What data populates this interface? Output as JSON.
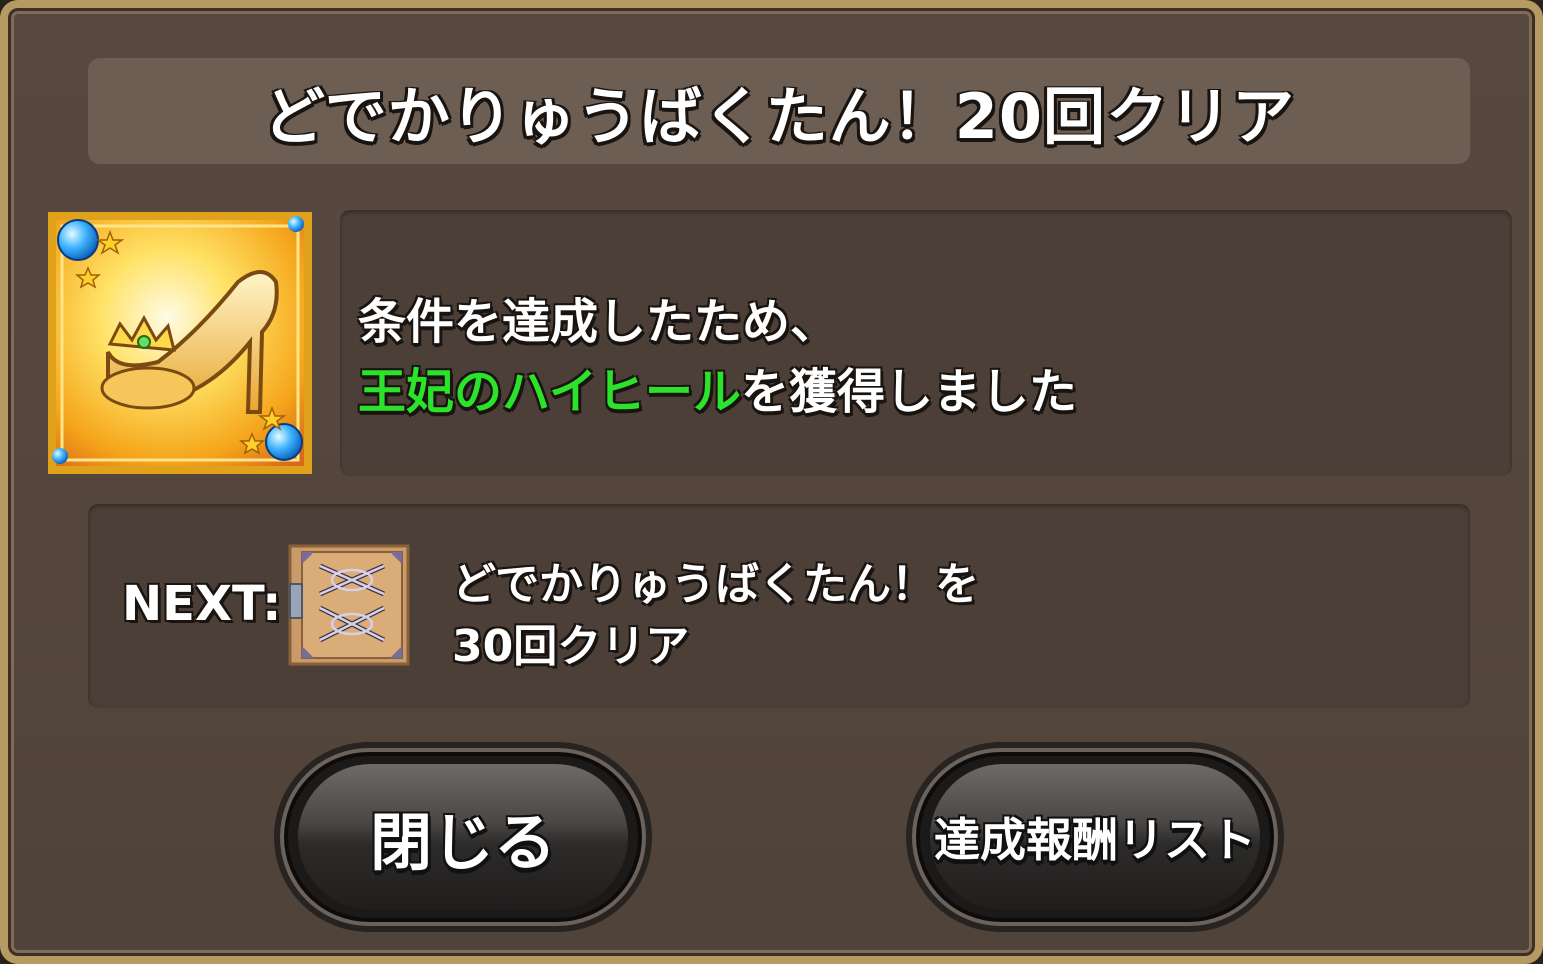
{
  "title": "どでかりゅうばくたん！20回クリア",
  "message": {
    "line1": "条件を達成したため、",
    "item_name": "王妃のハイヒール",
    "line2_suffix": "を獲得しました"
  },
  "reward_icon": "glass-high-heel-icon",
  "next": {
    "label": "NEXT:",
    "icon": "locked-chest-icon",
    "line1": "どでかりゅうばくたん！を",
    "line2": "30回クリア"
  },
  "buttons": {
    "close_label": "閉じる",
    "reward_list_label": "達成報酬リスト"
  },
  "colors": {
    "item_name": "#2ce32b",
    "frame_gold": "#b69a63",
    "panel": "#4b3f38"
  }
}
